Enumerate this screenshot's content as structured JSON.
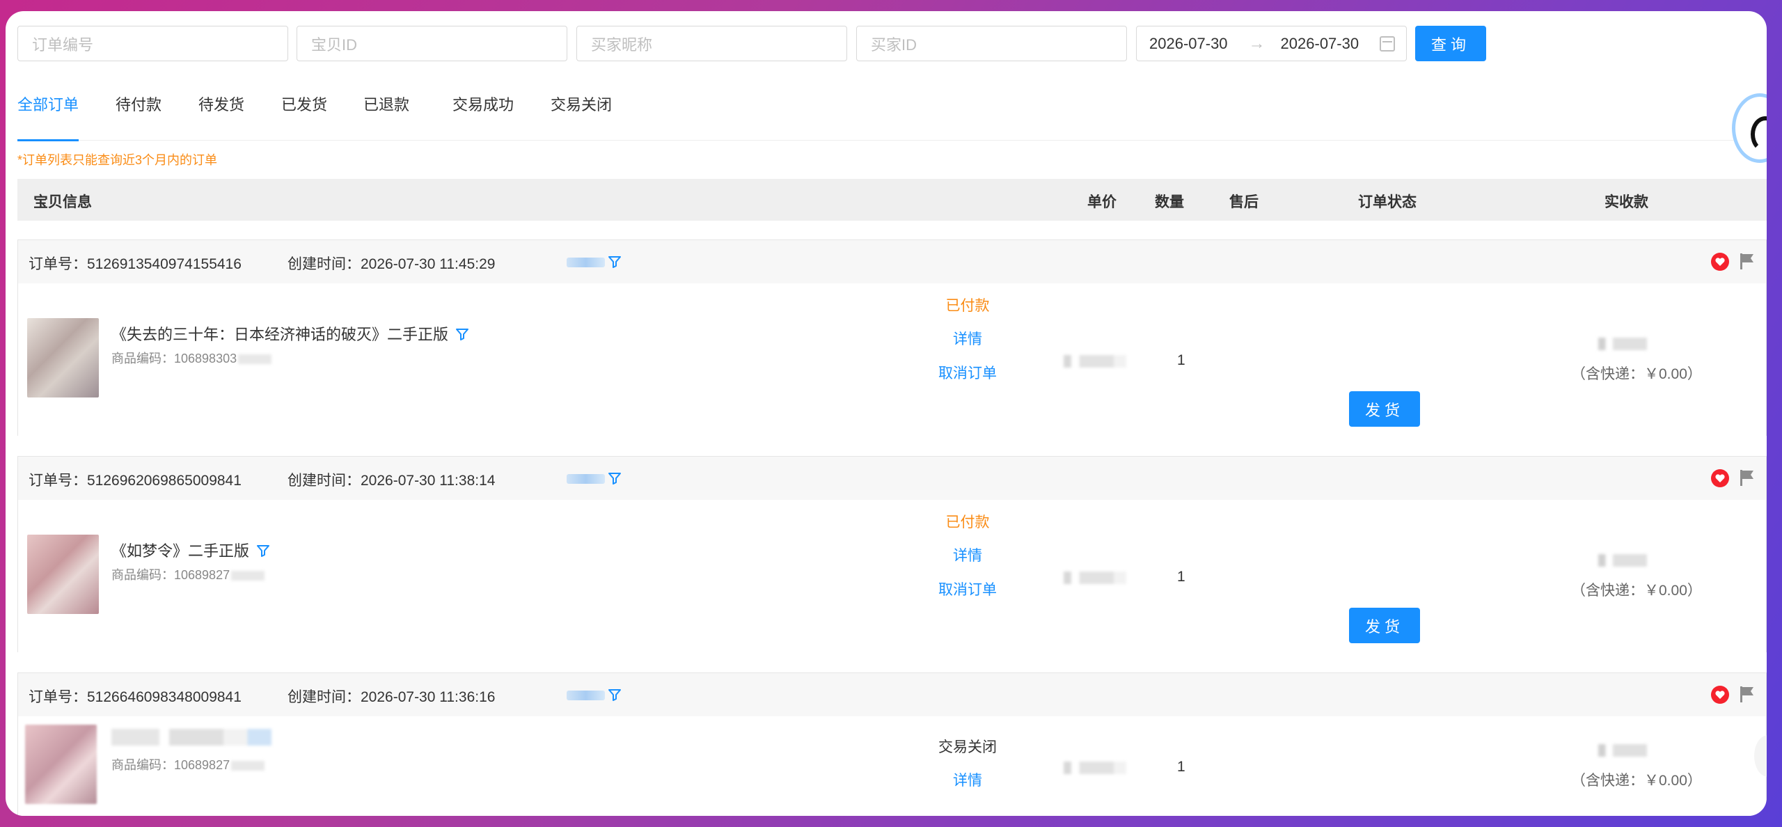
{
  "search": {
    "order_no_placeholder": "订单编号",
    "item_id_placeholder": "宝贝ID",
    "buyer_nick_placeholder": "买家昵称",
    "buyer_id_placeholder": "买家ID",
    "date_start": "2026-07-30",
    "date_end": "2026-07-30",
    "date_arrow": "→",
    "query_label": "查询"
  },
  "tabs": [
    {
      "label": "全部订单",
      "active": true
    },
    {
      "label": "待付款"
    },
    {
      "label": "待发货"
    },
    {
      "label": "已发货"
    },
    {
      "label": "已退款"
    },
    {
      "label": "交易成功"
    },
    {
      "label": "交易关闭"
    }
  ],
  "notice": "*订单列表只能查询近3个月内的订单",
  "table_header": {
    "item_info": "宝贝信息",
    "unit_price": "单价",
    "quantity": "数量",
    "after_sale": "售后",
    "order_status": "订单状态",
    "received": "实收款"
  },
  "orders": [
    {
      "order_no_label": "订单号：",
      "order_no": "5126913540974155416",
      "created_label": "创建时间：",
      "created_at": "2026-07-30 11:45:29",
      "title": "《失去的三十年：日本经济神话的破灭》二手正版",
      "code_label": "商品编码：",
      "code": "106898303",
      "quantity": "1",
      "status": "已付款",
      "detail": "详情",
      "cancel": "取消订单",
      "ship": "发货",
      "express": "（含快递：￥0.00）"
    },
    {
      "order_no_label": "订单号：",
      "order_no": "5126962069865009841",
      "created_label": "创建时间：",
      "created_at": "2026-07-30 11:38:14",
      "title": "《如梦令》二手正版",
      "code_label": "商品编码：",
      "code": "10689827",
      "quantity": "1",
      "status": "已付款",
      "detail": "详情",
      "cancel": "取消订单",
      "ship": "发货",
      "express": "（含快递：￥0.00）"
    },
    {
      "order_no_label": "订单号：",
      "order_no": "5126646098348009841",
      "created_label": "创建时间：",
      "created_at": "2026-07-30 11:36:16",
      "code_label": "商品编码：",
      "code": "10689827",
      "quantity": "1",
      "status": "交易关闭",
      "detail": "详情",
      "express": "（含快递：￥0.00）"
    }
  ],
  "colors": {
    "accent": "#1890ff",
    "paid": "#fa8c16",
    "flag_red": "#f5222d",
    "flag_gray": "#8c8c8c"
  }
}
